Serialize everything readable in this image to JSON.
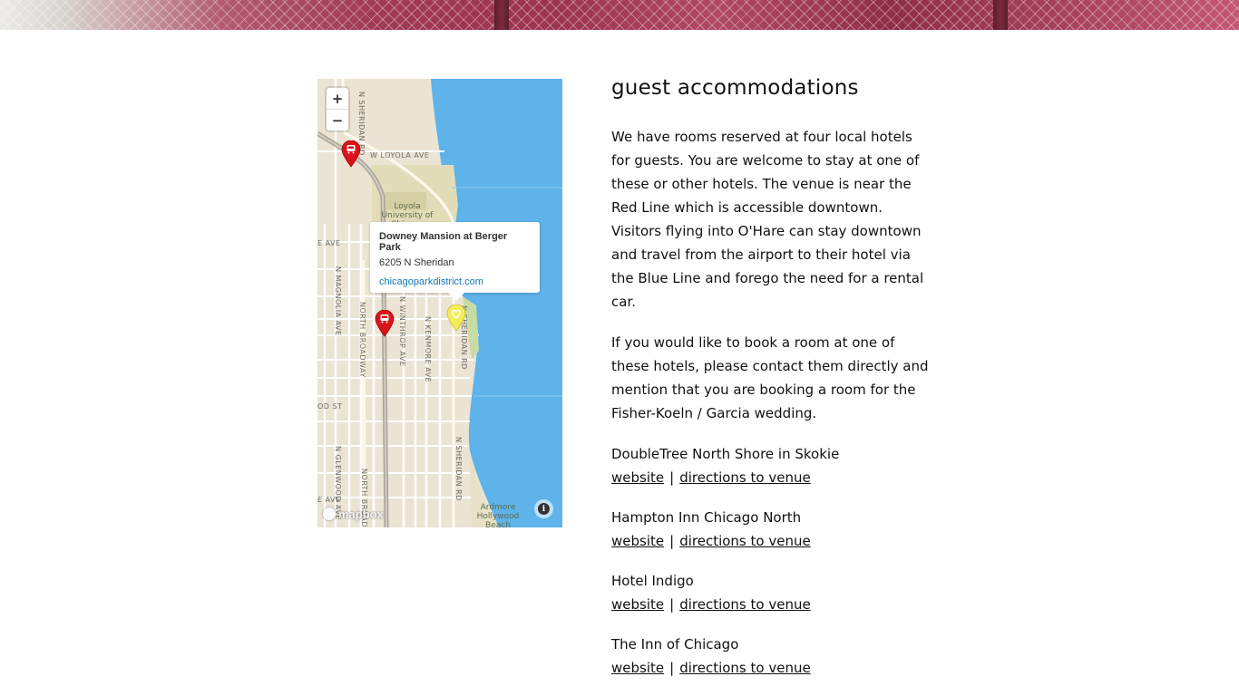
{
  "map": {
    "zoom_in": "+",
    "zoom_out": "−",
    "streets": {
      "sheridan_top": "N SHERIDAN RD",
      "loyola": "W LOYOLA AVE",
      "w_ave": "E AVE",
      "magnolia": "N MAGNOLIA AVE",
      "broadway": "NORTH BROADWAY",
      "winthrop": "N WINTHROP AVE",
      "kenmore": "N KENMORE AVE",
      "sheridan_rd": "N SHERIDAN RD",
      "sheridan_mid": "N SHERIDAN RD",
      "od_st": "OD ST",
      "glenwood": "N GLENWOOD AVE",
      "broadway_bottom": "NORTH BROADWAY",
      "e_ave": "E AVE"
    },
    "pois": {
      "loyola_university": "Loyola University of Chicago",
      "ardmore_beach": "Ardmore Hollywood Beach"
    },
    "popup": {
      "title": "Downey Mansion at Berger Park",
      "address": "6205 N Sheridan",
      "link": "chicagoparkdistrict.com"
    },
    "attribution": "mapbox",
    "info": "i"
  },
  "content": {
    "heading": "guest accommodations",
    "paragraph1": "We have rooms reserved at four local hotels for guests. You are welcome to stay at one of these or other hotels. The venue is near the Red Line which is accessible downtown. Visitors flying into O'Hare can stay downtown and travel from the airport to their hotel via the Blue Line and forego the need for a rental car.",
    "paragraph2": "If you would like to book a room at one of these hotels, please contact them directly and mention that you are booking a room for the Fisher-Koeln / Garcia wedding.",
    "hotels": [
      {
        "name": "DoubleTree North Shore in Skokie",
        "website": "website",
        "sep": "|",
        "directions": "directions to venue"
      },
      {
        "name": "Hampton Inn Chicago North",
        "website": "website",
        "sep": "|",
        "directions": "directions to venue"
      },
      {
        "name": "Hotel Indigo",
        "website": "website",
        "sep": "|",
        "directions": "directions to venue"
      },
      {
        "name": "The Inn of Chicago",
        "website": "website",
        "sep": "|",
        "directions": "directions to venue"
      }
    ]
  },
  "colors": {
    "water": "#5db3ea",
    "land": "#ebe3d4",
    "pin_red": "#d9141c",
    "pin_yellow": "#f5ec59",
    "link": "#1278b6"
  }
}
